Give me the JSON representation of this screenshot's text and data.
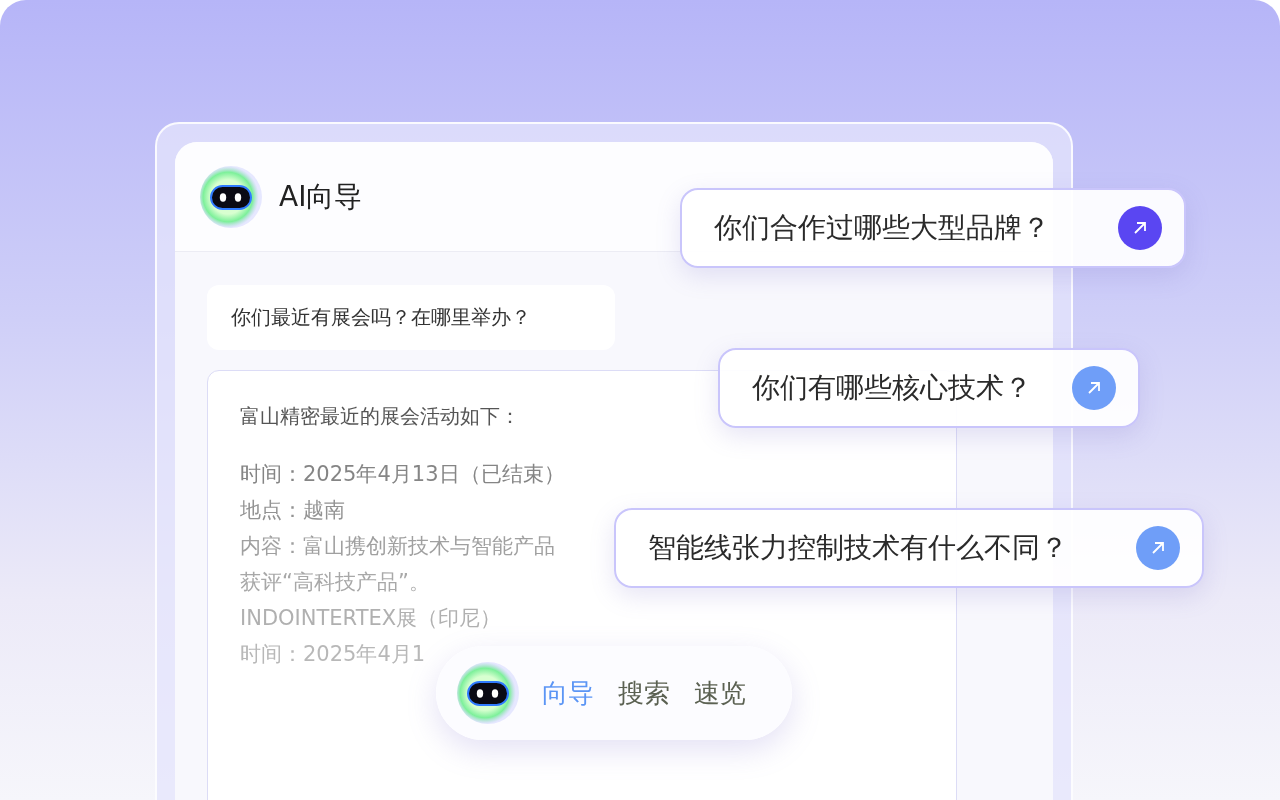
{
  "header": {
    "title": "AI向导"
  },
  "messages": [
    {
      "kind": "question",
      "text": "你们最近有展会吗？在哪里举办？"
    },
    {
      "kind": "answer",
      "heading": "富山精密最近的展会活动如下：",
      "lines": [
        "时间：2025年4月13日（已结束）",
        "地点：越南",
        "内容：富山携创新技术与智能产品",
        "获评“高科技产品”。",
        "INDOINTERTEX展（印尼）",
        "时间：2025年4月1"
      ]
    }
  ],
  "suggestions": [
    {
      "text": "你们合作过哪些大型品牌？",
      "color": "#5a46f2"
    },
    {
      "text": "你们有哪些核心技术？",
      "color": "#6f9ef8"
    },
    {
      "text": "智能线张力控制技术有什么不同？",
      "color": "#6f9ef8"
    }
  ],
  "dock": {
    "tabs": [
      {
        "label": "向导",
        "selected": true
      },
      {
        "label": "搜索",
        "selected": false
      },
      {
        "label": "速览",
        "selected": false
      }
    ]
  }
}
